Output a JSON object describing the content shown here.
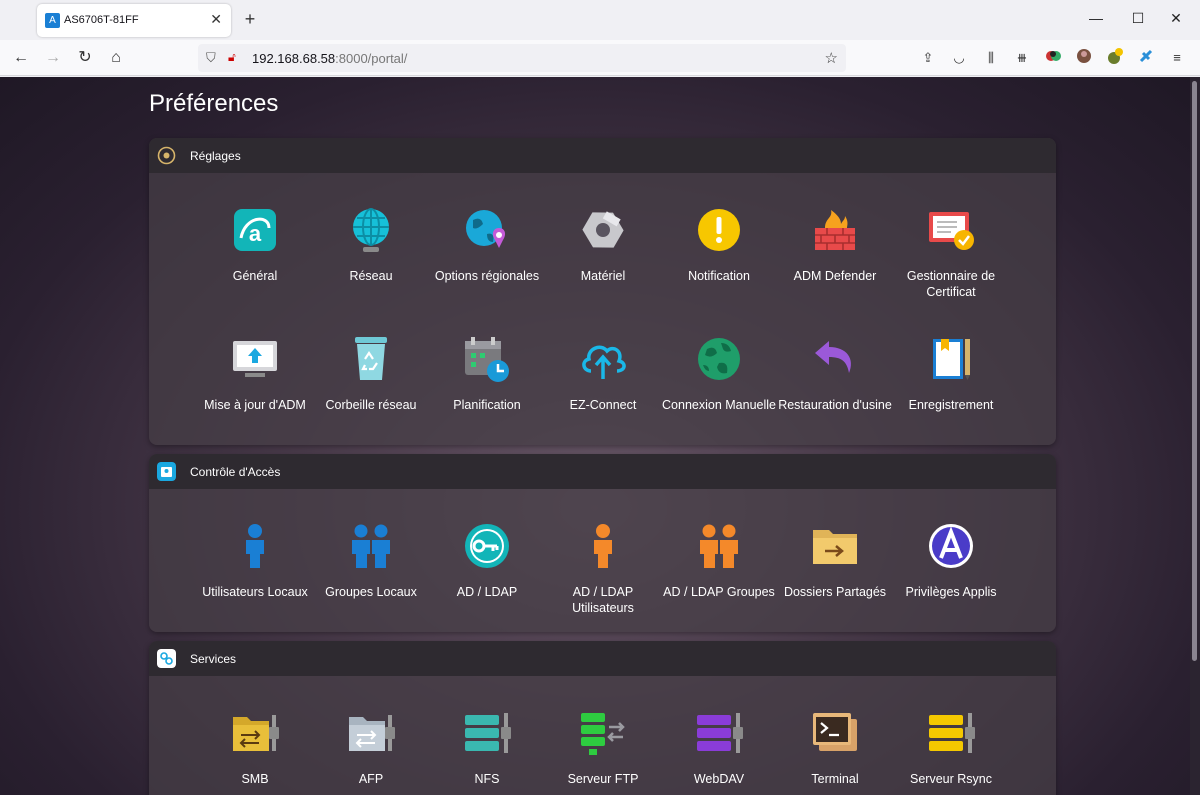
{
  "browser": {
    "tab_title": "AS6706T-81FF",
    "url_host": "192.168.68.58",
    "url_rest": ":8000/portal/"
  },
  "page": {
    "title": "Préférences"
  },
  "sections": [
    {
      "title": "Réglages",
      "items": [
        {
          "label": "Général",
          "icon": "general-icon"
        },
        {
          "label": "Réseau",
          "icon": "network-icon"
        },
        {
          "label": "Options régionales",
          "icon": "regional-options-icon"
        },
        {
          "label": "Matériel",
          "icon": "hardware-icon"
        },
        {
          "label": "Notification",
          "icon": "notification-icon"
        },
        {
          "label": "ADM Defender",
          "icon": "firewall-icon"
        },
        {
          "label": "Gestionnaire de Certificat",
          "icon": "certificate-icon"
        },
        {
          "label": "Mise à jour d'ADM",
          "icon": "adm-update-icon"
        },
        {
          "label": "Corbeille réseau",
          "icon": "recycle-bin-icon"
        },
        {
          "label": "Planification",
          "icon": "schedule-icon"
        },
        {
          "label": "EZ-Connect",
          "icon": "cloud-upload-icon"
        },
        {
          "label": "Connexion Manuelle",
          "icon": "globe-icon"
        },
        {
          "label": "Restauration d'usine",
          "icon": "undo-arrow-icon"
        },
        {
          "label": "Enregistrement",
          "icon": "registration-icon"
        }
      ]
    },
    {
      "title": "Contrôle d'Accès",
      "items": [
        {
          "label": "Utilisateurs Locaux",
          "icon": "user-icon"
        },
        {
          "label": "Groupes Locaux",
          "icon": "users-group-icon"
        },
        {
          "label": "AD / LDAP",
          "icon": "key-icon"
        },
        {
          "label": "AD / LDAP Utilisateurs",
          "icon": "user-icon"
        },
        {
          "label": "AD / LDAP Groupes",
          "icon": "users-group-icon"
        },
        {
          "label": "Dossiers Partagés",
          "icon": "shared-folder-icon"
        },
        {
          "label": "Privilèges Applis",
          "icon": "app-privileges-icon"
        }
      ]
    },
    {
      "title": "Services",
      "items": [
        {
          "label": "SMB",
          "icon": "smb-folder-icon"
        },
        {
          "label": "AFP",
          "icon": "afp-folder-icon"
        },
        {
          "label": "NFS",
          "icon": "nfs-server-icon"
        },
        {
          "label": "Serveur FTP",
          "icon": "ftp-server-icon"
        },
        {
          "label": "WebDAV",
          "icon": "webdav-server-icon"
        },
        {
          "label": "Terminal",
          "icon": "terminal-icon"
        },
        {
          "label": "Serveur Rsync",
          "icon": "rsync-server-icon"
        }
      ]
    }
  ]
}
